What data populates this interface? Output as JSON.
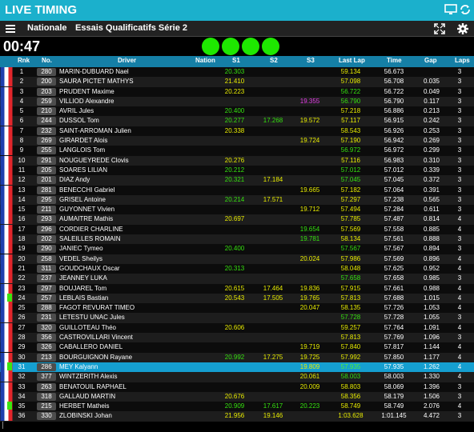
{
  "app": {
    "title": "LIVE TIMING",
    "monitor_icon": "monitor-icon",
    "refresh_icon": "refresh-icon"
  },
  "nav": {
    "championship": "Nationale",
    "session": "Essais Qualificatifs Série 2",
    "menu_icon": "menu-icon",
    "fullscreen_icon": "fullscreen-icon",
    "settings_icon": "gear-icon"
  },
  "timer": {
    "remaining": "00:47",
    "lights": [
      "green",
      "green",
      "green",
      "green"
    ]
  },
  "colors": {
    "accent": "#1bb0cc",
    "header": "#157fa6",
    "highlight": "#159fd0",
    "personal_best": "#e8ec00",
    "best": "#36e20f",
    "overall_best": "#e23ce5"
  },
  "headers": {
    "rnk": "Rnk",
    "no": "No.",
    "driver": "Driver",
    "nation": "Nation",
    "s1": "S1",
    "s2": "S2",
    "s3": "S3",
    "last": "Last Lap",
    "time": "Time",
    "gap": "Gap",
    "laps": "Laps"
  },
  "rows": [
    {
      "rnk": "1",
      "no": "280",
      "driver": "MARIN-DUBUARD Nael",
      "s1": "20.303",
      "s1c": "g",
      "s2": "",
      "s2c": "",
      "s3": "",
      "s3c": "",
      "last": "59.134",
      "lastc": "y",
      "time": "56.673",
      "gap": "",
      "laps": "3"
    },
    {
      "rnk": "2",
      "no": "200",
      "driver": "SAURA PICTET MATHYS",
      "s1": "21.410",
      "s1c": "y",
      "s2": "",
      "s2c": "",
      "s3": "",
      "s3c": "",
      "last": "57.098",
      "lastc": "y",
      "time": "56.708",
      "gap": "0.035",
      "laps": "3"
    },
    {
      "rnk": "3",
      "no": "203",
      "driver": "PRUDENT Maxime",
      "s1": "20.223",
      "s1c": "y",
      "s2": "",
      "s2c": "",
      "s3": "",
      "s3c": "",
      "last": "56.722",
      "lastc": "g",
      "time": "56.722",
      "gap": "0.049",
      "laps": "3"
    },
    {
      "rnk": "4",
      "no": "259",
      "driver": "VILLIOD Alexandre",
      "s1": "",
      "s1c": "",
      "s2": "",
      "s2c": "",
      "s3": "19.355",
      "s3c": "m",
      "last": "56.790",
      "lastc": "g",
      "time": "56.790",
      "gap": "0.117",
      "laps": "3"
    },
    {
      "rnk": "5",
      "no": "210",
      "driver": "AVRIL Jules",
      "s1": "20.400",
      "s1c": "g",
      "s2": "",
      "s2c": "",
      "s3": "",
      "s3c": "",
      "last": "57.218",
      "lastc": "y",
      "time": "56.886",
      "gap": "0.213",
      "laps": "3"
    },
    {
      "rnk": "6",
      "no": "244",
      "driver": "DUSSOL Tom",
      "s1": "20.277",
      "s1c": "g",
      "s2": "17.268",
      "s2c": "g",
      "s3": "19.572",
      "s3c": "y",
      "last": "57.117",
      "lastc": "y",
      "time": "56.915",
      "gap": "0.242",
      "laps": "3"
    },
    {
      "rnk": "7",
      "no": "232",
      "driver": "SAINT-ARROMAN Julien",
      "s1": "20.338",
      "s1c": "y",
      "s2": "",
      "s2c": "",
      "s3": "",
      "s3c": "",
      "last": "58.543",
      "lastc": "y",
      "time": "56.926",
      "gap": "0.253",
      "laps": "3"
    },
    {
      "rnk": "8",
      "no": "269",
      "driver": "GIRARDET Alois",
      "s1": "",
      "s1c": "",
      "s2": "",
      "s2c": "",
      "s3": "19.724",
      "s3c": "y",
      "last": "57.190",
      "lastc": "y",
      "time": "56.942",
      "gap": "0.269",
      "laps": "3"
    },
    {
      "rnk": "9",
      "no": "255",
      "driver": "LANGLOIS Tom",
      "s1": "",
      "s1c": "",
      "s2": "",
      "s2c": "",
      "s3": "",
      "s3c": "",
      "last": "56.972",
      "lastc": "g",
      "time": "56.972",
      "gap": "0.299",
      "laps": "3"
    },
    {
      "rnk": "10",
      "no": "291",
      "driver": "NOUGUEYREDE Clovis",
      "s1": "20.276",
      "s1c": "y",
      "s2": "",
      "s2c": "",
      "s3": "",
      "s3c": "",
      "last": "57.116",
      "lastc": "y",
      "time": "56.983",
      "gap": "0.310",
      "laps": "3"
    },
    {
      "rnk": "11",
      "no": "205",
      "driver": "SOARES LILIAN",
      "s1": "20.212",
      "s1c": "g",
      "s2": "",
      "s2c": "",
      "s3": "",
      "s3c": "",
      "last": "57.012",
      "lastc": "g",
      "time": "57.012",
      "gap": "0.339",
      "laps": "3"
    },
    {
      "rnk": "12",
      "no": "201",
      "driver": "DIAZ Andy",
      "s1": "20.321",
      "s1c": "g",
      "s2": "17.184",
      "s2c": "y",
      "s3": "",
      "s3c": "",
      "last": "57.045",
      "lastc": "g",
      "time": "57.045",
      "gap": "0.372",
      "laps": "3"
    },
    {
      "rnk": "13",
      "no": "281",
      "driver": "BENECCHI Gabriel",
      "s1": "",
      "s1c": "",
      "s2": "",
      "s2c": "",
      "s3": "19.665",
      "s3c": "y",
      "last": "57.182",
      "lastc": "y",
      "time": "57.064",
      "gap": "0.391",
      "laps": "3"
    },
    {
      "rnk": "14",
      "no": "295",
      "driver": "GRISEL Antoine",
      "s1": "20.214",
      "s1c": "g",
      "s2": "17.571",
      "s2c": "y",
      "s3": "",
      "s3c": "",
      "last": "57.297",
      "lastc": "y",
      "time": "57.238",
      "gap": "0.565",
      "laps": "3"
    },
    {
      "rnk": "15",
      "no": "211",
      "driver": "GUYONNET Vivien",
      "s1": "",
      "s1c": "",
      "s2": "",
      "s2c": "",
      "s3": "19.712",
      "s3c": "y",
      "last": "57.494",
      "lastc": "y",
      "time": "57.284",
      "gap": "0.611",
      "laps": "3"
    },
    {
      "rnk": "16",
      "no": "293",
      "driver": "AUMAITRE Mathis",
      "s1": "20.697",
      "s1c": "y",
      "s2": "",
      "s2c": "",
      "s3": "",
      "s3c": "",
      "last": "57.785",
      "lastc": "y",
      "time": "57.487",
      "gap": "0.814",
      "laps": "4"
    },
    {
      "rnk": "17",
      "no": "296",
      "driver": "CORDIER CHARLINE",
      "s1": "",
      "s1c": "",
      "s2": "",
      "s2c": "",
      "s3": "19.654",
      "s3c": "g",
      "last": "57.569",
      "lastc": "y",
      "time": "57.558",
      "gap": "0.885",
      "laps": "4"
    },
    {
      "rnk": "18",
      "no": "202",
      "driver": "SALEILLES ROMAIN",
      "s1": "",
      "s1c": "",
      "s2": "",
      "s2c": "",
      "s3": "19.781",
      "s3c": "g",
      "last": "58.134",
      "lastc": "y",
      "time": "57.561",
      "gap": "0.888",
      "laps": "3"
    },
    {
      "rnk": "19",
      "no": "290",
      "driver": "JANIEC Tymeo",
      "s1": "20.400",
      "s1c": "g",
      "s2": "",
      "s2c": "",
      "s3": "",
      "s3c": "",
      "last": "57.567",
      "lastc": "g",
      "time": "57.567",
      "gap": "0.894",
      "laps": "3"
    },
    {
      "rnk": "20",
      "no": "258",
      "driver": "VEDEL Sheilys",
      "s1": "",
      "s1c": "",
      "s2": "",
      "s2c": "",
      "s3": "20.024",
      "s3c": "y",
      "last": "57.986",
      "lastc": "y",
      "time": "57.569",
      "gap": "0.896",
      "laps": "4"
    },
    {
      "rnk": "21",
      "no": "311",
      "driver": "GOUDCHAUX Oscar",
      "s1": "20.313",
      "s1c": "g",
      "s2": "",
      "s2c": "",
      "s3": "",
      "s3c": "",
      "last": "58.048",
      "lastc": "y",
      "time": "57.625",
      "gap": "0.952",
      "laps": "4"
    },
    {
      "rnk": "22",
      "no": "237",
      "driver": "JEANNEY LUKA",
      "s1": "",
      "s1c": "",
      "s2": "",
      "s2c": "",
      "s3": "",
      "s3c": "",
      "last": "57.658",
      "lastc": "g",
      "time": "57.658",
      "gap": "0.985",
      "laps": "3"
    },
    {
      "rnk": "23",
      "no": "297",
      "driver": "BOUJAREL Tom",
      "s1": "20.615",
      "s1c": "y",
      "s2": "17.464",
      "s2c": "y",
      "s3": "19.836",
      "s3c": "y",
      "last": "57.915",
      "lastc": "y",
      "time": "57.661",
      "gap": "0.988",
      "laps": "4"
    },
    {
      "rnk": "24",
      "no": "257",
      "driver": "LEBLAIS Bastian",
      "s1": "20.543",
      "s1c": "y",
      "s2": "17.505",
      "s2c": "y",
      "s3": "19.765",
      "s3c": "y",
      "last": "57.813",
      "lastc": "y",
      "time": "57.688",
      "gap": "1.015",
      "laps": "4"
    },
    {
      "rnk": "25",
      "no": "288",
      "driver": "FAGOT REVURAT TIMEO",
      "s1": "",
      "s1c": "",
      "s2": "",
      "s2c": "",
      "s3": "20.047",
      "s3c": "y",
      "last": "58.135",
      "lastc": "y",
      "time": "57.726",
      "gap": "1.053",
      "laps": "4"
    },
    {
      "rnk": "26",
      "no": "231",
      "driver": "LETESTU UNAC Jules",
      "s1": "",
      "s1c": "",
      "s2": "",
      "s2c": "",
      "s3": "",
      "s3c": "",
      "last": "57.728",
      "lastc": "g",
      "time": "57.728",
      "gap": "1.055",
      "laps": "3"
    },
    {
      "rnk": "27",
      "no": "320",
      "driver": "GUILLOTEAU Théo",
      "s1": "20.606",
      "s1c": "y",
      "s2": "",
      "s2c": "",
      "s3": "",
      "s3c": "",
      "last": "59.257",
      "lastc": "y",
      "time": "57.764",
      "gap": "1.091",
      "laps": "4"
    },
    {
      "rnk": "28",
      "no": "356",
      "driver": "CASTROVILLARI Vincent",
      "s1": "",
      "s1c": "",
      "s2": "",
      "s2c": "",
      "s3": "",
      "s3c": "",
      "last": "57.813",
      "lastc": "y",
      "time": "57.769",
      "gap": "1.096",
      "laps": "3"
    },
    {
      "rnk": "29",
      "no": "326",
      "driver": "CABALLERO DANIEL",
      "s1": "",
      "s1c": "",
      "s2": "",
      "s2c": "",
      "s3": "19.719",
      "s3c": "y",
      "last": "57.840",
      "lastc": "y",
      "time": "57.817",
      "gap": "1.144",
      "laps": "4"
    },
    {
      "rnk": "30",
      "no": "213",
      "driver": "BOURGUIGNON Rayane",
      "s1": "20.992",
      "s1c": "g",
      "s2": "17.275",
      "s2c": "y",
      "s3": "19.725",
      "s3c": "y",
      "last": "57.992",
      "lastc": "y",
      "time": "57.850",
      "gap": "1.177",
      "laps": "4"
    },
    {
      "rnk": "31",
      "no": "286",
      "driver": "MEY Kalyann",
      "s1": "",
      "s1c": "",
      "s2": "",
      "s2c": "",
      "s3": "19.809",
      "s3c": "y",
      "last": "57.935",
      "lastc": "g",
      "time": "57.935",
      "gap": "1.262",
      "laps": "4",
      "hl": true
    },
    {
      "rnk": "32",
      "no": "377",
      "driver": "WINTZERITH Alexis",
      "s1": "",
      "s1c": "",
      "s2": "",
      "s2c": "",
      "s3": "20.061",
      "s3c": "y",
      "last": "58.003",
      "lastc": "g",
      "time": "58.003",
      "gap": "1.330",
      "laps": "4"
    },
    {
      "rnk": "33",
      "no": "263",
      "driver": "BENATOUIL RAPHAEL",
      "s1": "",
      "s1c": "",
      "s2": "",
      "s2c": "",
      "s3": "20.009",
      "s3c": "y",
      "last": "58.803",
      "lastc": "y",
      "time": "58.069",
      "gap": "1.396",
      "laps": "3"
    },
    {
      "rnk": "34",
      "no": "318",
      "driver": "GALLAUD MARTIN",
      "s1": "20.676",
      "s1c": "y",
      "s2": "",
      "s2c": "",
      "s3": "",
      "s3c": "",
      "last": "58.356",
      "lastc": "y",
      "time": "58.179",
      "gap": "1.506",
      "laps": "3"
    },
    {
      "rnk": "35",
      "no": "215",
      "driver": "HERBET Matheis",
      "s1": "20.909",
      "s1c": "g",
      "s2": "17.617",
      "s2c": "g",
      "s3": "20.223",
      "s3c": "g",
      "last": "58.749",
      "lastc": "y",
      "time": "58.749",
      "gap": "2.076",
      "laps": "4"
    },
    {
      "rnk": "36",
      "no": "330",
      "driver": "ZLOBINSKI Johan",
      "s1": "21.956",
      "s1c": "y",
      "s2": "19.146",
      "s2c": "y",
      "s3": "",
      "s3c": "",
      "last": "1:03.628",
      "lastc": "y",
      "time": "1:01.145",
      "gap": "4.472",
      "laps": "3"
    }
  ],
  "marked_rows": [
    "24",
    "31",
    "35"
  ]
}
